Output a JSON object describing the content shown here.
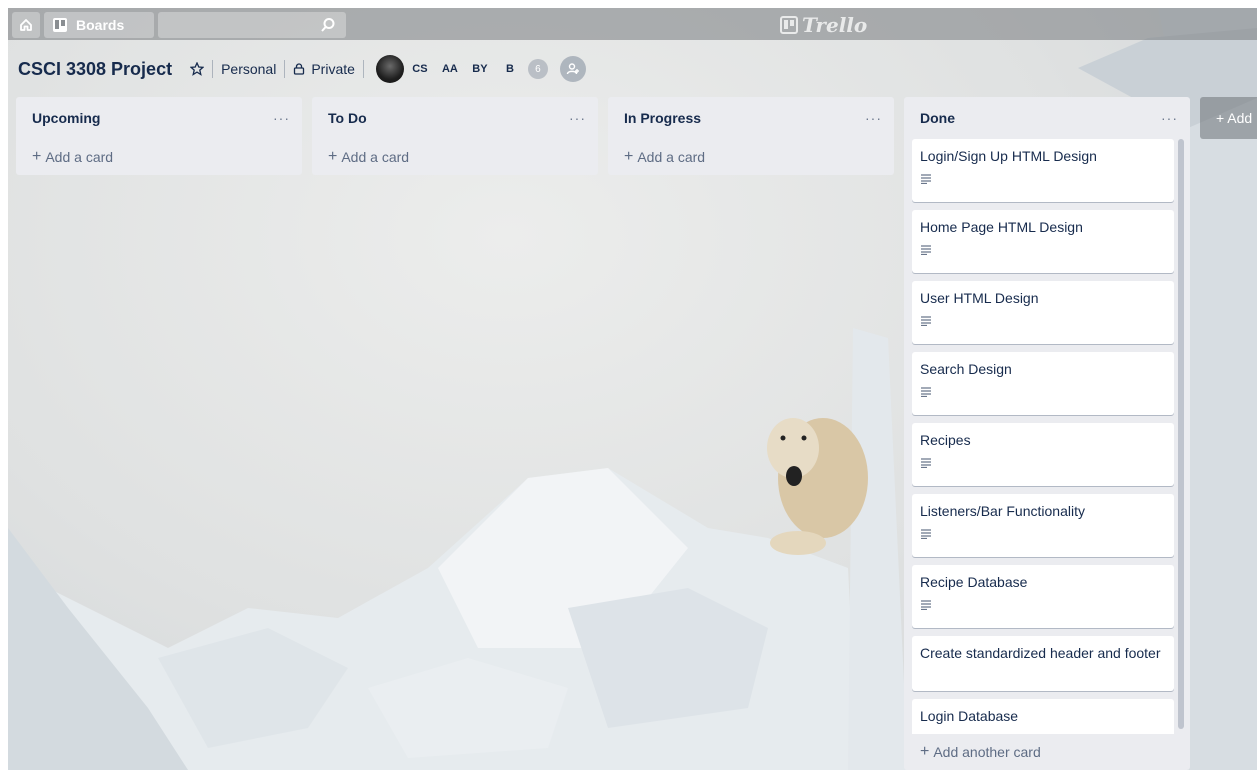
{
  "topbar": {
    "boards_label": "Boards",
    "logo_text": "Trello",
    "icons": [
      "home-icon",
      "boards-icon",
      "search-icon",
      "trello-logo-icon"
    ]
  },
  "board": {
    "title": "CSCI 3308 Project",
    "team": "Personal",
    "visibility": "Private",
    "members": [
      "CS",
      "AA",
      "BY",
      "B"
    ],
    "member_count": "6"
  },
  "lists": [
    {
      "title": "Upcoming",
      "menu": "···",
      "add_label": "Add a card",
      "cards": []
    },
    {
      "title": "To Do",
      "menu": "···",
      "add_label": "Add a card",
      "cards": []
    },
    {
      "title": "In Progress",
      "menu": "···",
      "add_label": "Add a card",
      "cards": []
    },
    {
      "title": "Done",
      "menu": "···",
      "add_label": "Add another card",
      "cards": [
        "Login/Sign Up HTML Design",
        "Home Page HTML Design",
        "User HTML Design",
        "Search Design",
        "Recipes",
        "Listeners/Bar Functionality",
        "Recipe Database",
        "Create standardized header and footer",
        "Login Database"
      ]
    }
  ],
  "add_list_label": "+ Add",
  "colors": {
    "list_bg": "#ebecf0",
    "text": "#172b4d",
    "muted": "#5e6c84"
  }
}
